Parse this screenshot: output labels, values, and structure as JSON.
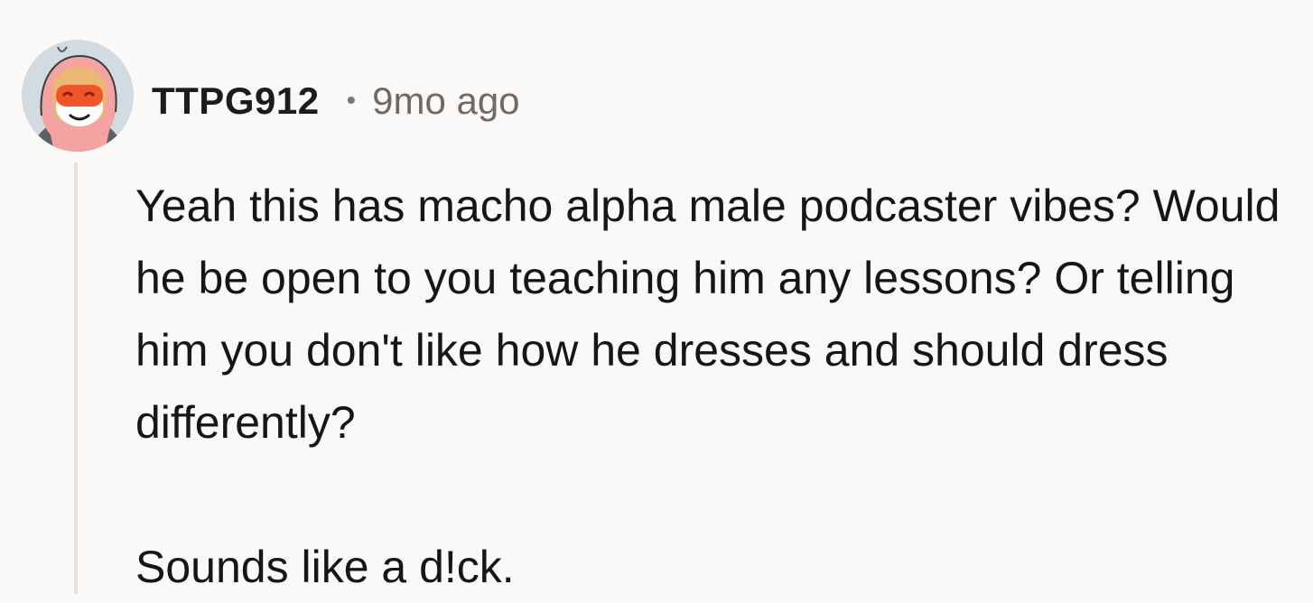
{
  "comment": {
    "author": "TTPG912",
    "separator": "•",
    "timestamp": "9mo ago",
    "avatar_icon": "user-avatar",
    "paragraphs": [
      "Yeah this has macho alpha male podcaster vibes? Would he be open to you teaching him any lessons? Or telling him you don't like how he dresses and should dress differently?",
      "Sounds like a d!ck."
    ]
  },
  "colors": {
    "background": "#faf9f7",
    "thread_line": "#e6e1dc",
    "avatar_hood": "#f3a3a0",
    "avatar_visor": "#f0552a"
  }
}
